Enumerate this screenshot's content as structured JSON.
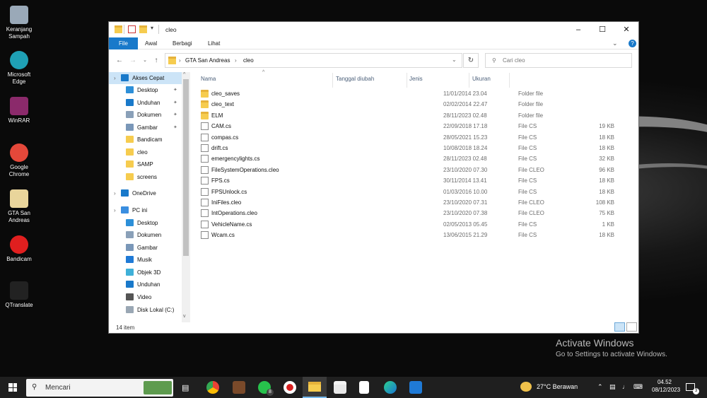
{
  "desktop": {
    "icons": [
      {
        "label_1": "Keranjang",
        "label_2": "Sampah",
        "color": "#9aa9b8"
      },
      {
        "label_1": "Microsoft",
        "label_2": "Edge",
        "color": "#1fa0b5"
      },
      {
        "label_1": "WinRAR",
        "label_2": "",
        "color": "#8b2a6b"
      },
      {
        "label_1": "Google",
        "label_2": "Chrome",
        "color": "#e4483a"
      },
      {
        "label_1": "GTA San",
        "label_2": "Andreas",
        "color": "#e9d59b"
      },
      {
        "label_1": "Bandicam",
        "label_2": "",
        "color": "#e01f1f"
      },
      {
        "label_1": "QTranslate",
        "label_2": "",
        "color": "#222222"
      }
    ]
  },
  "window": {
    "title": "cleo",
    "ribbon_tabs": [
      "File",
      "Awal",
      "Berbagi",
      "Lihat"
    ],
    "breadcrumb": [
      "GTA San Andreas",
      "cleo"
    ],
    "search_placeholder": "Cari cleo",
    "nav_pane": [
      {
        "label": "Akses Cepat",
        "icon": "star-icon",
        "pinned": false,
        "level": 0,
        "selected": true
      },
      {
        "label": "Desktop",
        "icon": "desktop-icon",
        "pinned": true,
        "level": 1
      },
      {
        "label": "Unduhan",
        "icon": "download-icon",
        "pinned": true,
        "level": 1
      },
      {
        "label": "Dokumen",
        "icon": "documents-icon",
        "pinned": true,
        "level": 1
      },
      {
        "label": "Gambar",
        "icon": "pictures-icon",
        "pinned": true,
        "level": 1
      },
      {
        "label": "Bandicam",
        "icon": "folder-icon",
        "pinned": false,
        "level": 1
      },
      {
        "label": "cleo",
        "icon": "folder-icon",
        "pinned": false,
        "level": 1
      },
      {
        "label": "SAMP",
        "icon": "folder-icon",
        "pinned": false,
        "level": 1
      },
      {
        "label": "screens",
        "icon": "folder-icon",
        "pinned": false,
        "level": 1
      },
      {
        "label": "OneDrive",
        "icon": "cloud-icon",
        "pinned": false,
        "level": 0
      },
      {
        "label": "PC ini",
        "icon": "computer-icon",
        "pinned": false,
        "level": 0
      },
      {
        "label": "Desktop",
        "icon": "desktop-icon",
        "pinned": false,
        "level": 1
      },
      {
        "label": "Dokumen",
        "icon": "documents-icon",
        "pinned": false,
        "level": 1
      },
      {
        "label": "Gambar",
        "icon": "pictures-icon",
        "pinned": false,
        "level": 1
      },
      {
        "label": "Musik",
        "icon": "music-icon",
        "pinned": false,
        "level": 1
      },
      {
        "label": "Objek 3D",
        "icon": "cube-icon",
        "pinned": false,
        "level": 1
      },
      {
        "label": "Unduhan",
        "icon": "download-icon",
        "pinned": false,
        "level": 1
      },
      {
        "label": "Video",
        "icon": "video-icon",
        "pinned": false,
        "level": 1
      },
      {
        "label": "Disk Lokal (C:)",
        "icon": "drive-icon",
        "pinned": false,
        "level": 1
      }
    ],
    "columns": [
      "Nama",
      "Tanggal diubah",
      "Jenis",
      "Ukuran"
    ],
    "files": [
      {
        "name": "cleo_saves",
        "date": "11/01/2014 23.04",
        "type": "Folder file",
        "size": "",
        "kind": "folder"
      },
      {
        "name": "cleo_text",
        "date": "02/02/2014 22.47",
        "type": "Folder file",
        "size": "",
        "kind": "folder"
      },
      {
        "name": "ELM",
        "date": "28/11/2023 02.48",
        "type": "Folder file",
        "size": "",
        "kind": "folder"
      },
      {
        "name": "CAM.cs",
        "date": "22/09/2018 17.18",
        "type": "File CS",
        "size": "19 KB",
        "kind": "file"
      },
      {
        "name": "compas.cs",
        "date": "28/05/2021 15.23",
        "type": "File CS",
        "size": "18 KB",
        "kind": "file"
      },
      {
        "name": "drift.cs",
        "date": "10/08/2018 18.24",
        "type": "File CS",
        "size": "18 KB",
        "kind": "file"
      },
      {
        "name": "emergencylights.cs",
        "date": "28/11/2023 02.48",
        "type": "File CS",
        "size": "32 KB",
        "kind": "file"
      },
      {
        "name": "FileSystemOperations.cleo",
        "date": "23/10/2020 07.30",
        "type": "File CLEO",
        "size": "96 KB",
        "kind": "file"
      },
      {
        "name": "FPS.cs",
        "date": "30/11/2014 13.41",
        "type": "File CS",
        "size": "18 KB",
        "kind": "file"
      },
      {
        "name": "FPSUnlock.cs",
        "date": "01/03/2016 10.00",
        "type": "File CS",
        "size": "18 KB",
        "kind": "file"
      },
      {
        "name": "IniFiles.cleo",
        "date": "23/10/2020 07.31",
        "type": "File CLEO",
        "size": "108 KB",
        "kind": "file"
      },
      {
        "name": "IntOperations.cleo",
        "date": "23/10/2020 07.38",
        "type": "File CLEO",
        "size": "75 KB",
        "kind": "file"
      },
      {
        "name": "VehicleName.cs",
        "date": "02/05/2013 05.45",
        "type": "File CS",
        "size": "1 KB",
        "kind": "file"
      },
      {
        "name": "Wcam.cs",
        "date": "13/06/2015 21.29",
        "type": "File CS",
        "size": "18 KB",
        "kind": "file"
      }
    ],
    "status": "14 item"
  },
  "watermark": {
    "line1": "Activate Windows",
    "line2": "Go to Settings to activate Windows."
  },
  "taskbar": {
    "search_placeholder": "Mencari",
    "apps": [
      "task-view",
      "chrome",
      "game",
      "whatsapp",
      "bandicam",
      "file-explorer",
      "store",
      "notepad",
      "edge",
      "mail"
    ],
    "whatsapp_badge": "8",
    "weather": "27°C  Berawan",
    "time": "04.52",
    "date": "08/12/2023",
    "notifications": "3"
  }
}
